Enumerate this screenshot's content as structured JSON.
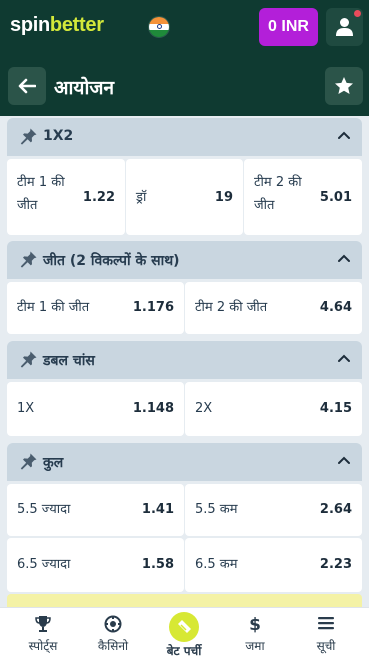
{
  "app": {
    "logo_part1": "spin",
    "logo_part2": "better",
    "balance_label": "0 INR"
  },
  "header": {
    "title": "आयोजन"
  },
  "markets": [
    {
      "title": "1X2",
      "outcomes": [
        {
          "label": "टीम 1 की जीत",
          "odd": "1.22"
        },
        {
          "label": "ड्रॉ",
          "odd": "19"
        },
        {
          "label": "टीम 2 की जीत",
          "odd": "5.01"
        }
      ]
    },
    {
      "title": "जीत (2 विकल्पों के साथ)",
      "outcomes": [
        {
          "label": "टीम 1 की जीत",
          "odd": "1.176"
        },
        {
          "label": "टीम 2 की जीत",
          "odd": "4.64"
        }
      ]
    },
    {
      "title": "डबल चांस",
      "outcomes": [
        {
          "label": "1X",
          "odd": "1.148"
        },
        {
          "label": "2X",
          "odd": "4.15"
        }
      ]
    },
    {
      "title": "कुल",
      "outcomes": [
        {
          "label": "5.5 ज्यादा",
          "odd": "1.41"
        },
        {
          "label": "5.5 कम",
          "odd": "2.64"
        },
        {
          "label": "6.5 ज्यादा",
          "odd": "1.58"
        },
        {
          "label": "6.5 कम",
          "odd": "2.23"
        }
      ]
    }
  ],
  "bottom_nav": [
    {
      "label": "स्पोर्ट्स",
      "icon": "trophy-icon"
    },
    {
      "label": "कैसिनो",
      "icon": "casino-chip-icon"
    },
    {
      "label": "बेट पर्ची",
      "icon": "bet-slip-icon",
      "active": true
    },
    {
      "label": "जमा",
      "icon": "dollar-icon"
    },
    {
      "label": "सूची",
      "icon": "menu-icon"
    }
  ],
  "colors": {
    "topbar": "#0f3a31",
    "balance_button": "#b31fd9",
    "accent": "#d7e834",
    "section_header": "#c9d6e0"
  }
}
